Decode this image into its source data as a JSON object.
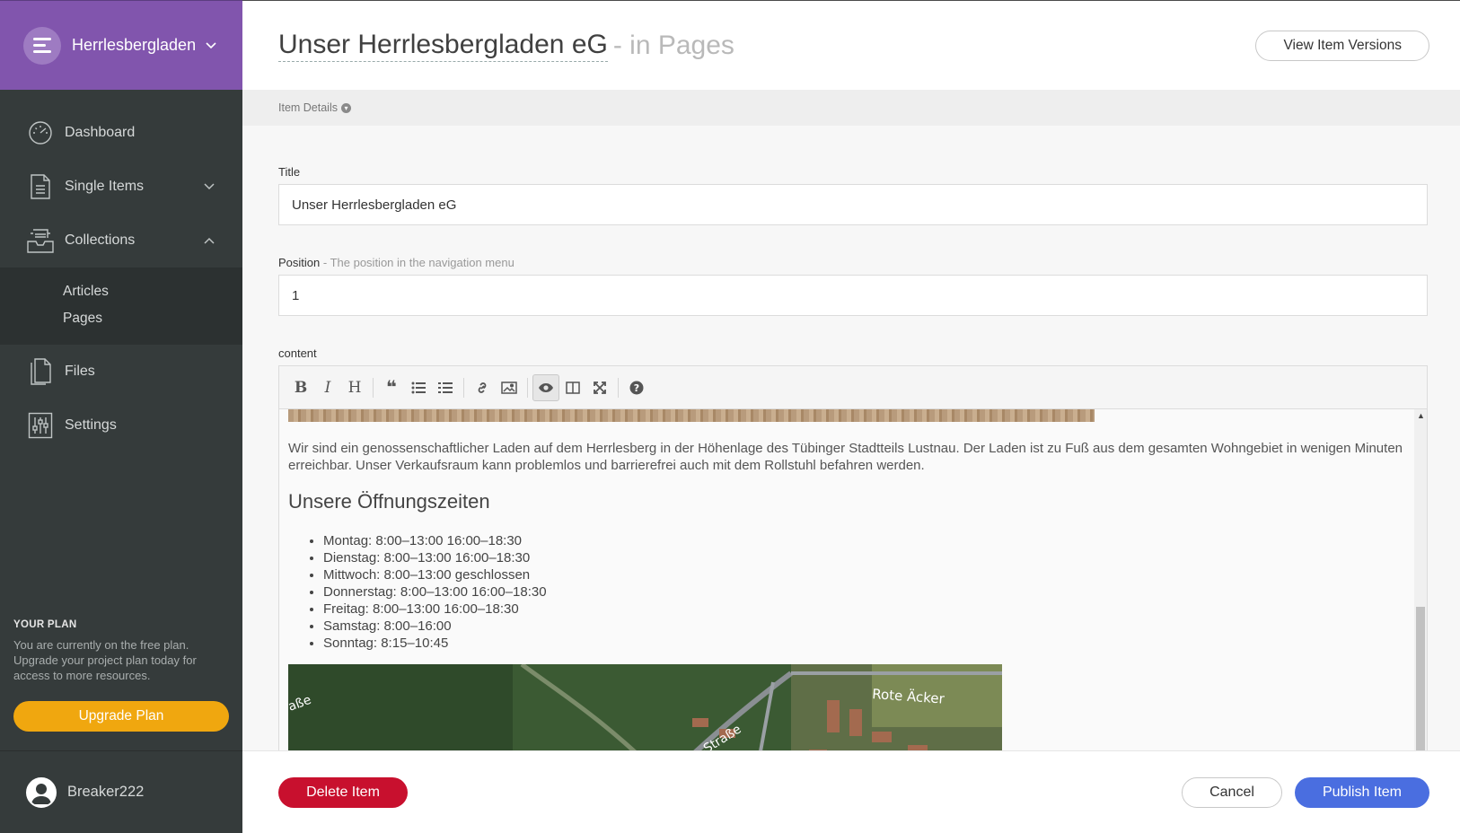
{
  "sidebar": {
    "project_name": "Herrlesbergladen",
    "nav": [
      {
        "label": "Dashboard",
        "icon": "dashboard-icon"
      },
      {
        "label": "Single Items",
        "icon": "document-icon"
      },
      {
        "label": "Collections",
        "icon": "inbox-icon"
      },
      {
        "label": "Files",
        "icon": "files-icon"
      },
      {
        "label": "Settings",
        "icon": "sliders-icon"
      }
    ],
    "collections_sub": [
      "Articles",
      "Pages"
    ],
    "plan": {
      "title": "YOUR PLAN",
      "text": "You are currently on the free plan. Upgrade your project plan today for access to more resources.",
      "button": "Upgrade Plan"
    },
    "user": {
      "name": "Breaker222"
    }
  },
  "header": {
    "title": "Unser Herrlesbergladen eG",
    "subtitle": "- in Pages",
    "versions_button": "View Item Versions"
  },
  "details_bar": {
    "label": "Item Details"
  },
  "form": {
    "title_label": "Title",
    "title_value": "Unser Herrlesbergladen eG",
    "position_label": "Position",
    "position_hint": "- The position in the navigation menu",
    "position_value": "1",
    "content_label": "content"
  },
  "content": {
    "paragraph": "Wir sind ein genossenschaftlicher Laden auf dem Herrlesberg in der Höhenlage des Tübinger Stadtteils Lustnau. Der Laden ist zu Fuß aus dem gesamten Wohngebiet in wenigen Minuten erreichbar. Unser Verkaufsraum kann problemlos und barrierefrei auch mit dem Rollstuhl befahren werden.",
    "heading": "Unsere Öffnungszeiten",
    "hours": [
      "Montag: 8:00–13:00 16:00–18:30",
      "Dienstag: 8:00–13:00 16:00–18:30",
      "Mittwoch: 8:00–13:00 geschlossen",
      "Donnerstag: 8:00–13:00 16:00–18:30",
      "Freitag: 8:00–13:00 16:00–18:30",
      "Samstag: 8:00–16:00",
      "Sonntag: 8:15–10:45"
    ],
    "map_labels": [
      "Rote Äcker",
      "-Knapp-Straße",
      "aße"
    ]
  },
  "footer": {
    "delete_button": "Delete Item",
    "cancel_button": "Cancel",
    "publish_button": "Publish Item"
  },
  "colors": {
    "brand": "#8155ad",
    "sidebar": "#353b3b",
    "upgrade": "#f0a70f",
    "delete": "#c8102e",
    "publish": "#4a6ee0"
  }
}
